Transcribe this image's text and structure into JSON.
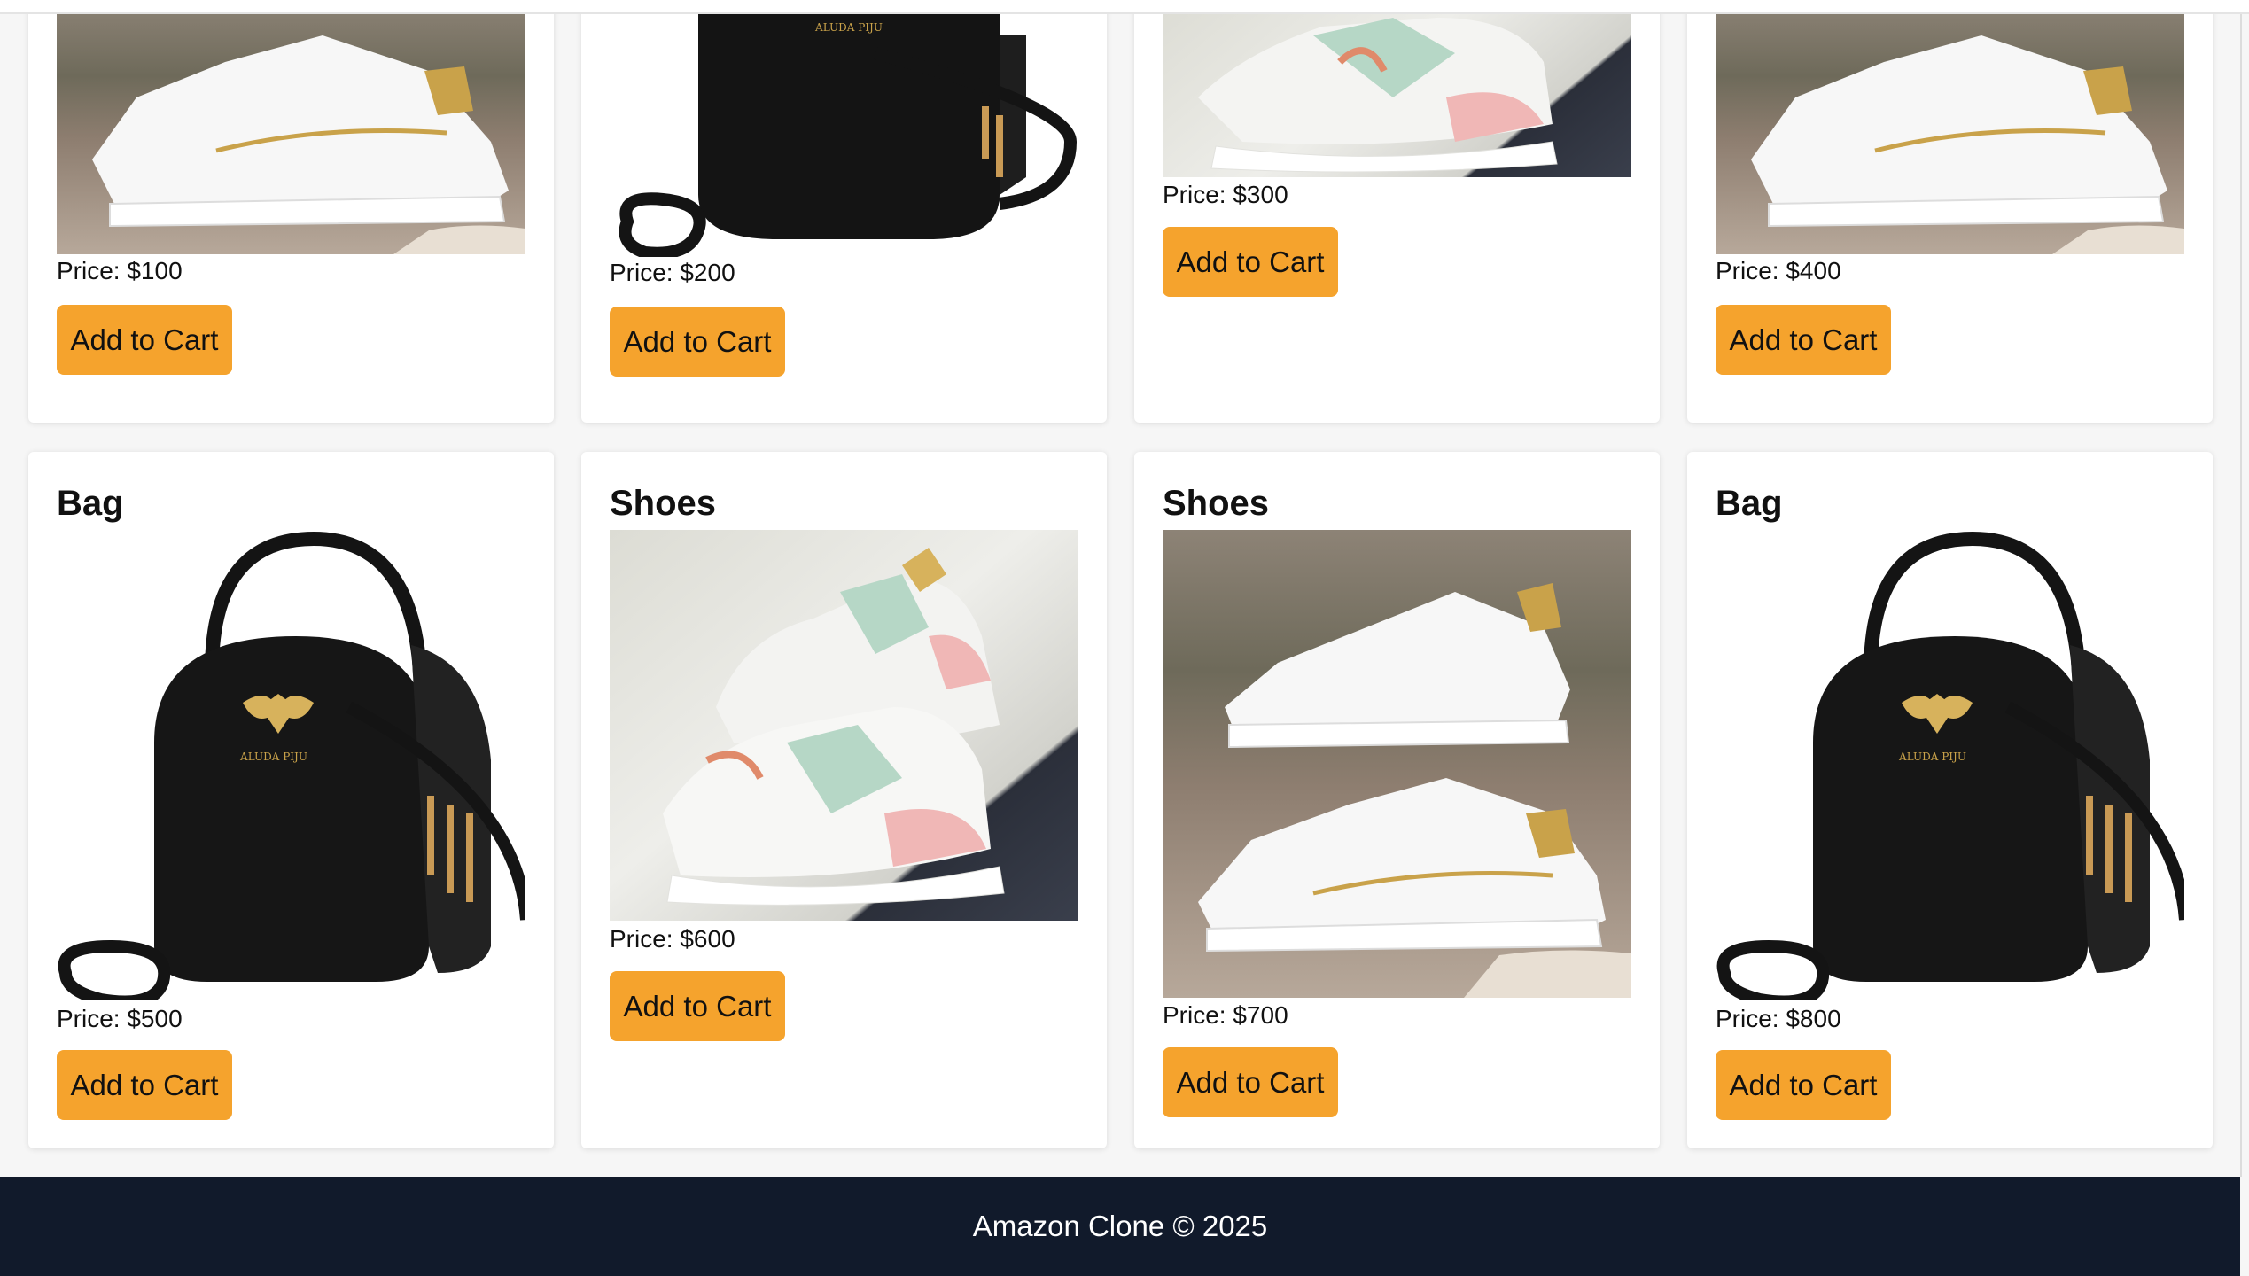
{
  "products": [
    {
      "title": "",
      "price": "Price: $100",
      "button": "Add to Cart",
      "image": "white-sneaker-photo"
    },
    {
      "title": "",
      "price": "Price: $200",
      "button": "Add to Cart",
      "image": "black-bag-photo"
    },
    {
      "title": "",
      "price": "Price: $300",
      "button": "Add to Cart",
      "image": "pastel-sneaker-photo"
    },
    {
      "title": "",
      "price": "Price: $400",
      "button": "Add to Cart",
      "image": "white-sneaker-photo"
    },
    {
      "title": "Bag",
      "price": "Price: $500",
      "button": "Add to Cart",
      "image": "black-bag-photo"
    },
    {
      "title": "Shoes",
      "price": "Price: $600",
      "button": "Add to Cart",
      "image": "pastel-sneaker-photo"
    },
    {
      "title": "Shoes",
      "price": "Price: $700",
      "button": "Add to Cart",
      "image": "white-sneaker-photo"
    },
    {
      "title": "Bag",
      "price": "Price: $800",
      "button": "Add to Cart",
      "image": "black-bag-photo"
    }
  ],
  "footer": {
    "text": "Amazon Clone © 2025"
  },
  "colors": {
    "accent_button": "#f5a32d",
    "footer_bg": "#111a2b",
    "page_bg": "#f6f6f6",
    "card_bg": "#ffffff"
  }
}
